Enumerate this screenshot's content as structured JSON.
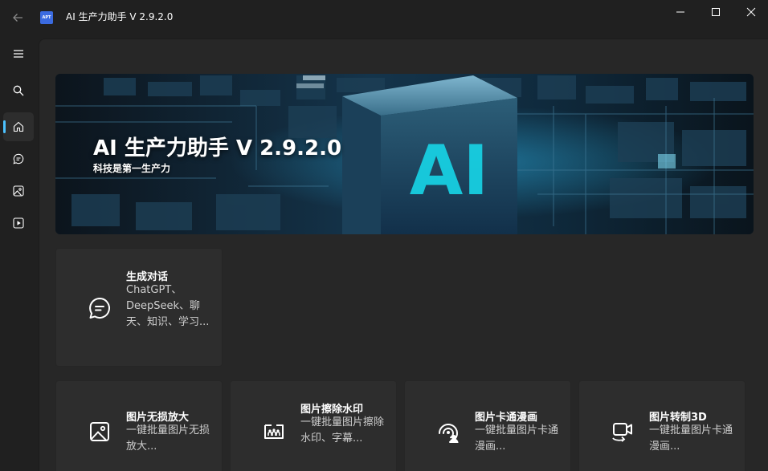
{
  "window": {
    "app_icon_text": "APT",
    "title": "AI 生产力助手 V 2.9.2.0"
  },
  "nav": {
    "items": [
      "menu-icon",
      "search-icon",
      "home-icon",
      "chat-icon",
      "image-icon",
      "video-icon"
    ],
    "active": "home",
    "accent": "#4cc2ff"
  },
  "hero": {
    "title": "AI 生产力助手 V 2.9.2.0",
    "subtitle": "科技是第一生产力",
    "badge": "AI"
  },
  "cards": [
    {
      "title": "生成对话",
      "desc": "ChatGPT、DeepSeek、聊天、知识、学习...",
      "icon": "chat-icon"
    },
    {
      "title": "图片无损放大",
      "desc": "一键批量图片无损放大...",
      "icon": "image-icon"
    },
    {
      "title": "图片擦除水印",
      "desc": "一键批量图片擦除水印、字幕...",
      "icon": "watermark-icon"
    },
    {
      "title": "图片卡通漫画",
      "desc": "一键批量图片卡通漫画...",
      "icon": "cartoon-icon"
    },
    {
      "title": "图片转制3D",
      "desc": "一键批量图片卡通漫画...",
      "icon": "3d-video-icon"
    }
  ]
}
